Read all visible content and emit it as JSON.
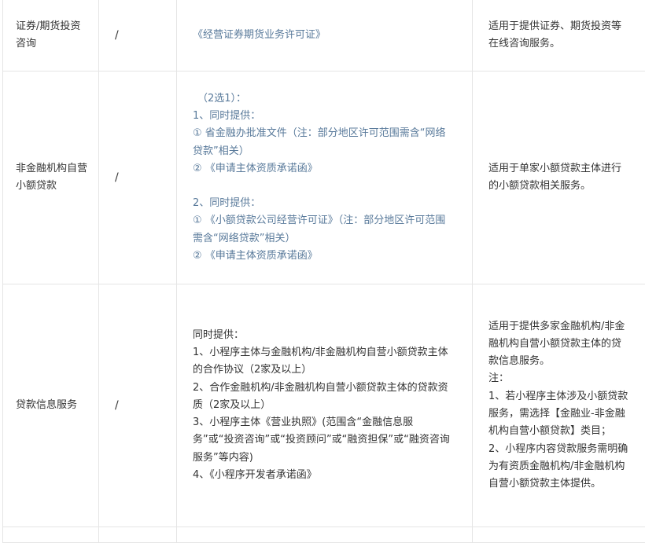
{
  "rows": [
    {
      "category": "证券/期货投资咨询",
      "col2": "/",
      "materials": [
        "《经营证券期货业务许可证》"
      ],
      "scope": "适用于提供证券、期货投资等在线咨询服务。"
    },
    {
      "category": "非金融机构自营小额贷款",
      "col2": "/",
      "materials": [
        "（2选1）：",
        "1、同时提供：",
        "① 省金融办批准文件（注：部分地区许可范围需含“网络贷款”相关）",
        "② 《申请主体资质承诺函》",
        "",
        "2、同时提供：",
        "① 《小额贷款公司经营许可证》（注：部分地区许可范围需含“网络贷款”相关）",
        "② 《申请主体资质承诺函》"
      ],
      "scope": "适用于单家小额贷款主体进行的小额贷款相关服务。"
    },
    {
      "category": "贷款信息服务",
      "col2": "/",
      "materials": [
        "同时提供：",
        "1、小程序主体与金融机构/非金融机构自营小额贷款主体的合作协议（2家及以上）",
        "2、合作金融机构/非金融机构自营小额贷款主体的贷款资质（2家及以上）",
        "3、小程序主体《营业执照》(范围含“金融信息服务”或“投资咨询”或“投资顾问”或“融资担保”或“融资咨询服务”等内容)",
        "4、《小程序开发者承诺函》"
      ],
      "scope": [
        "适用于提供多家金融机构/非金融机构自营小额贷款主体的贷款信息服务。",
        "注：",
        "1、若小程序主体涉及小额贷款服务，需选择【金融业-非金融机构自营小额贷款】类目；",
        "2、小程序内容贷款服务需明确为有资质金融机构/非金融机构自营小额贷款主体提供。"
      ]
    }
  ]
}
